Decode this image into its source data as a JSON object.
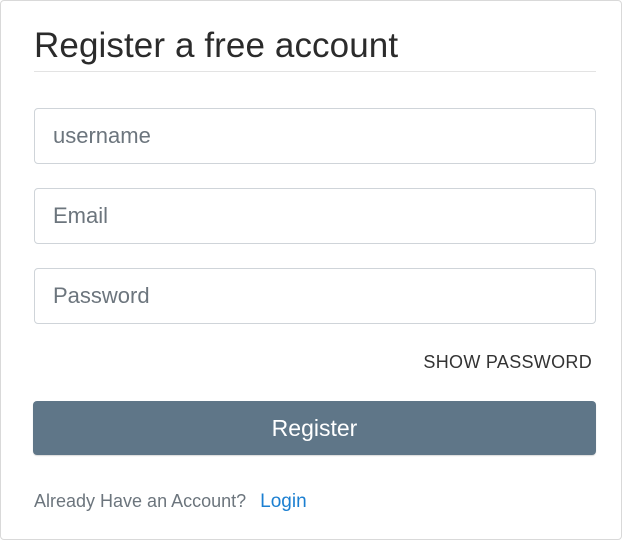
{
  "form": {
    "title": "Register a free account",
    "username_placeholder": "username",
    "email_placeholder": "Email",
    "password_placeholder": "Password",
    "show_password_label": "SHOW PASSWORD",
    "register_label": "Register",
    "footer_text": "Already Have an Account?",
    "login_label": "Login"
  },
  "colors": {
    "button_bg": "#5f7688",
    "link": "#1b7fd1"
  }
}
